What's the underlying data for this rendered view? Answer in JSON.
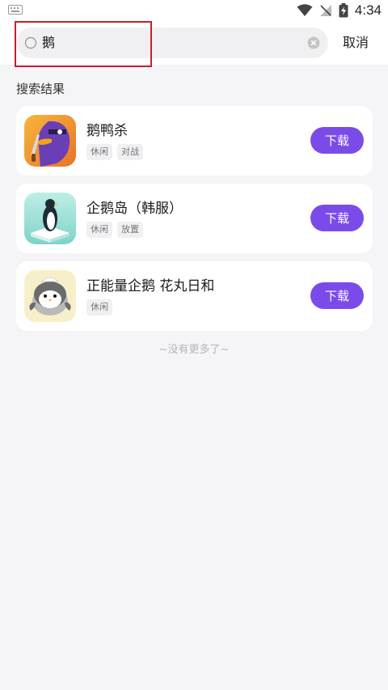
{
  "status_bar": {
    "time": "4:34"
  },
  "search": {
    "query": "鹅",
    "cancel_label": "取消"
  },
  "section_title": "搜索结果",
  "results": [
    {
      "name": "鹅鸭杀",
      "tags": [
        "休闲",
        "对战"
      ],
      "button": "下载",
      "icon": "goose-duck-app-icon"
    },
    {
      "name": "企鹅岛（韩服）",
      "tags": [
        "休闲",
        "放置"
      ],
      "button": "下载",
      "icon": "penguin-isle-app-icon"
    },
    {
      "name": "正能量企鹅 花丸日和",
      "tags": [
        "休闲"
      ],
      "button": "下载",
      "icon": "positive-penguin-app-icon"
    }
  ],
  "footer_text": "~没有更多了~",
  "colors": {
    "accent": "#7b4bea",
    "highlight_border": "#c8202a",
    "background": "#f5f5f7"
  }
}
